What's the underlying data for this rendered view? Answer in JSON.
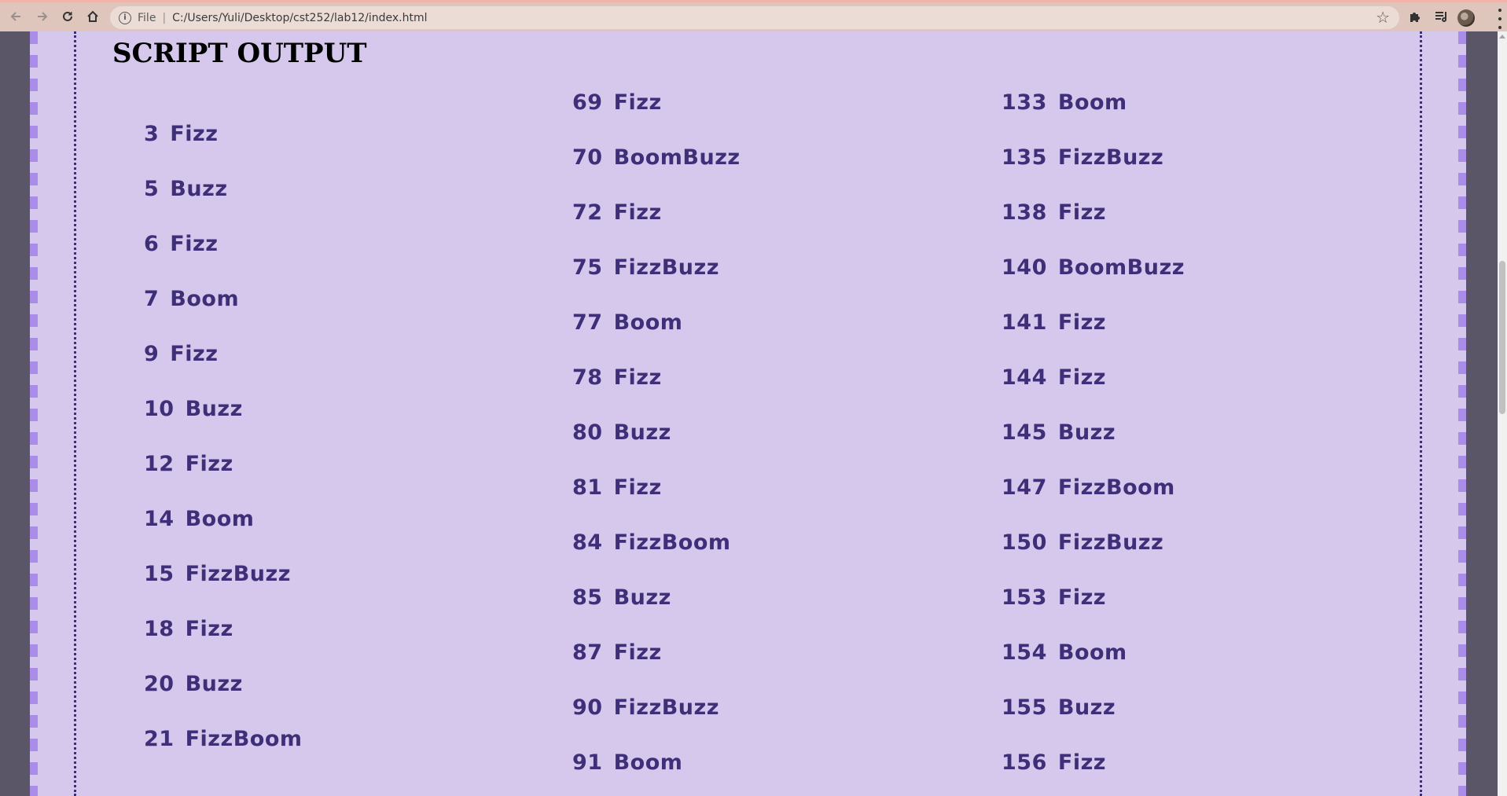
{
  "browser": {
    "back_icon": "arrow-left-icon",
    "forward_icon": "arrow-right-icon",
    "reload_icon": "reload-icon",
    "home_icon": "home-icon",
    "scheme_label": "File",
    "url": "C:/Users/Yuli/Desktop/cst252/lab12/index.html",
    "bookmark_icon": "star-icon",
    "extensions_icon": "puzzle-icon",
    "reading_list_icon": "reading-list-icon",
    "profile_icon": "avatar-icon",
    "menu_icon": "kebab-menu-icon"
  },
  "colors": {
    "page_background": "#d5c8ec",
    "accent_dash": "#a98de8",
    "text": "#3e2f78",
    "outer_background": "#5a5668"
  },
  "section": {
    "heading": "SCRIPT OUTPUT"
  },
  "output": {
    "column1": [
      {
        "num": "3",
        "word": "Fizz"
      },
      {
        "num": "5",
        "word": "Buzz"
      },
      {
        "num": "6",
        "word": "Fizz"
      },
      {
        "num": "7",
        "word": "Boom"
      },
      {
        "num": "9",
        "word": "Fizz"
      },
      {
        "num": "10",
        "word": "Buzz"
      },
      {
        "num": "12",
        "word": "Fizz"
      },
      {
        "num": "14",
        "word": "Boom"
      },
      {
        "num": "15",
        "word": "FizzBuzz"
      },
      {
        "num": "18",
        "word": "Fizz"
      },
      {
        "num": "20",
        "word": "Buzz"
      },
      {
        "num": "21",
        "word": "FizzBoom"
      }
    ],
    "column2": [
      {
        "num": "69",
        "word": "Fizz"
      },
      {
        "num": "70",
        "word": "BoomBuzz"
      },
      {
        "num": "72",
        "word": "Fizz"
      },
      {
        "num": "75",
        "word": "FizzBuzz"
      },
      {
        "num": "77",
        "word": "Boom"
      },
      {
        "num": "78",
        "word": "Fizz"
      },
      {
        "num": "80",
        "word": "Buzz"
      },
      {
        "num": "81",
        "word": "Fizz"
      },
      {
        "num": "84",
        "word": "FizzBoom"
      },
      {
        "num": "85",
        "word": "Buzz"
      },
      {
        "num": "87",
        "word": "Fizz"
      },
      {
        "num": "90",
        "word": "FizzBuzz"
      },
      {
        "num": "91",
        "word": "Boom"
      }
    ],
    "column3": [
      {
        "num": "133",
        "word": "Boom"
      },
      {
        "num": "135",
        "word": "FizzBuzz"
      },
      {
        "num": "138",
        "word": "Fizz"
      },
      {
        "num": "140",
        "word": "BoomBuzz"
      },
      {
        "num": "141",
        "word": "Fizz"
      },
      {
        "num": "144",
        "word": "Fizz"
      },
      {
        "num": "145",
        "word": "Buzz"
      },
      {
        "num": "147",
        "word": "FizzBoom"
      },
      {
        "num": "150",
        "word": "FizzBuzz"
      },
      {
        "num": "153",
        "word": "Fizz"
      },
      {
        "num": "154",
        "word": "Boom"
      },
      {
        "num": "155",
        "word": "Buzz"
      },
      {
        "num": "156",
        "word": "Fizz"
      }
    ]
  }
}
